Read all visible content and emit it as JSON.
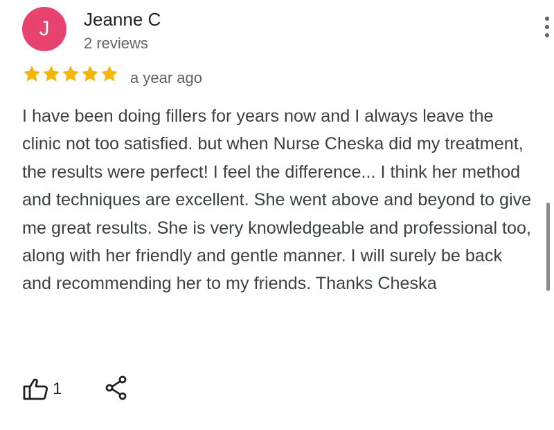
{
  "review": {
    "author_initial": "J",
    "author_name": "Jeanne C",
    "author_review_count": "2 reviews",
    "rating": 5,
    "rating_max": 5,
    "date": "a year ago",
    "text": "I have been doing fillers for years now and I always leave the clinic not too satisfied. but when Nurse Cheska did my treatment, the results were perfect! I feel the difference... I think her method and techniques are excellent. She went above and beyond to give me great results. She is very knowledgeable and professional too, along with her friendly and gentle manner. I will surely be back and recommending her to my friends. Thanks Cheska",
    "like_count": "1"
  },
  "icons": {
    "more": "more-vert-icon",
    "star": "star-icon",
    "like": "thumbs-up-icon",
    "share": "share-icon"
  },
  "colors": {
    "avatar_bg": "#e8436e",
    "star": "#f5b50a",
    "secondary_text": "#5f6368",
    "primary_text": "#202124"
  }
}
